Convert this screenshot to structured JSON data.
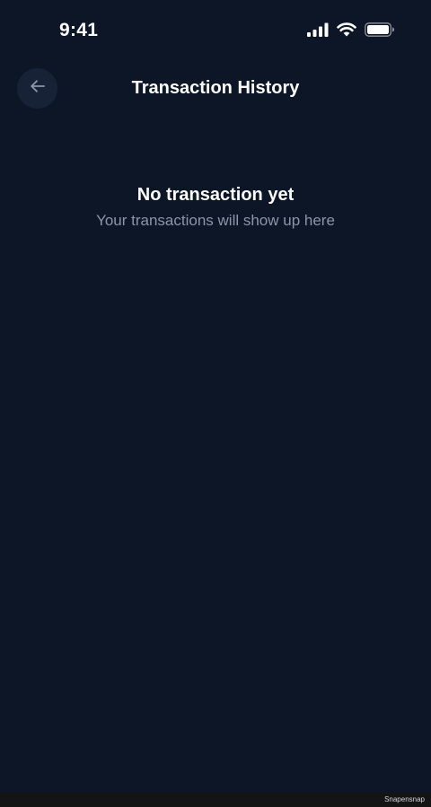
{
  "status_bar": {
    "time": "9:41",
    "icons": [
      "cellular-signal-icon",
      "wifi-icon",
      "battery-icon"
    ]
  },
  "header": {
    "title": "Transaction History",
    "back_icon": "arrow-left-icon"
  },
  "empty_state": {
    "title": "No transaction yet",
    "subtitle": "Your transactions will show up here"
  },
  "footer": {
    "watermark": "Snapensnap"
  },
  "colors": {
    "background": "#0d1627",
    "back_button_bg": "#172236",
    "subtitle_text": "#8b96a8",
    "footer_bg": "#141414"
  }
}
